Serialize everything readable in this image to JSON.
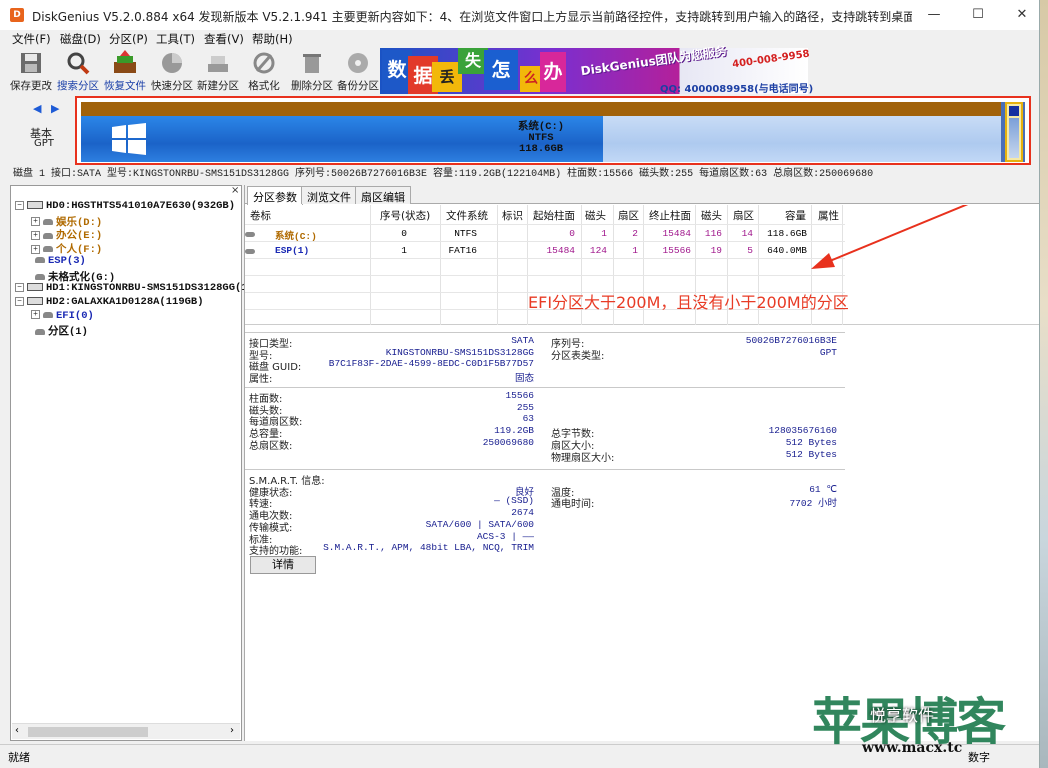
{
  "window": {
    "title": "DiskGenius V5.2.0.884 x64   发现新版本 V5.2.1.941 主要更新内容如下：4、在浏览文件窗口上方显示当前路径控件，支持跳转到用户输入的路径，支持跳转到桌面及我的文档。",
    "app_icon_glyph": "D",
    "minimize": "—",
    "maximize": "☐",
    "close": "✕"
  },
  "menu": [
    "文件(F)",
    "磁盘(D)",
    "分区(P)",
    "工具(T)",
    "查看(V)",
    "帮助(H)"
  ],
  "toolbar": [
    {
      "label": "保存更改",
      "icon": "save-disk-icon"
    },
    {
      "label": "搜索分区",
      "icon": "magnifier-icon"
    },
    {
      "label": "恢复文件",
      "icon": "recover-files-icon"
    },
    {
      "label": "快速分区",
      "icon": "pie-chart-icon"
    },
    {
      "label": "新建分区",
      "icon": "new-partition-icon"
    },
    {
      "label": "格式化",
      "icon": "format-icon"
    },
    {
      "label": "删除分区",
      "icon": "trash-icon"
    },
    {
      "label": "备份分区",
      "icon": "backup-icon"
    }
  ],
  "banner": {
    "chars": [
      "数",
      "据",
      "丢",
      "失",
      "怎",
      "么",
      "办"
    ],
    "brand": "DiskGenius团队为您服务",
    "phone": "400-008-9958",
    "qq": "QQ: 4000089958(与电话同号)"
  },
  "disk_map": {
    "nav_arrows": "◀ ▶",
    "kind": "基本",
    "style": "GPT",
    "partition_label": "系统(C:)",
    "partition_fs": "NTFS",
    "partition_size": "118.6GB",
    "used_fraction": 0.567
  },
  "disk_info": "磁盘 1 接口:SATA  型号:KINGSTONRBU-SMS151DS3128GG  序列号:50026B7276016B3E  容量:119.2GB(122104MB)  柱面数:15566  磁头数:255  每道扇区数:63  总扇区数:250069680",
  "tree": {
    "close": "×",
    "items": [
      {
        "label": "HD0:HGSTHTS541010A7E630(932GB)",
        "kind": "disk",
        "color": "#111"
      },
      {
        "label": "娱乐(D:)",
        "kind": "part",
        "color": "#b06a00"
      },
      {
        "label": "办公(E:)",
        "kind": "part",
        "color": "#b06a00"
      },
      {
        "label": "个人(F:)",
        "kind": "part",
        "color": "#b06a00"
      },
      {
        "label": "ESP(3)",
        "kind": "part",
        "color": "#1b2ab4"
      },
      {
        "label": "未格式化(G:)",
        "kind": "part",
        "color": "#111"
      },
      {
        "label": "HD1:KINGSTONRBU-SMS151DS3128GG(1",
        "kind": "disk",
        "color": "#111"
      },
      {
        "label": "HD2:GALAXKA1D0128A(119GB)",
        "kind": "disk",
        "color": "#111"
      },
      {
        "label": "EFI(0)",
        "kind": "part",
        "color": "#1b2ab4"
      },
      {
        "label": "分区(1)",
        "kind": "part",
        "color": "#111"
      }
    ]
  },
  "tabs": [
    "分区参数",
    "浏览文件",
    "扇区编辑"
  ],
  "table": {
    "headers": [
      "卷标",
      "序号(状态)",
      "文件系统",
      "标识",
      "起始柱面",
      "磁头",
      "扇区",
      "终止柱面",
      "磁头",
      "扇区",
      "容量",
      "属性"
    ],
    "rows": [
      [
        "系统(C:)",
        "0",
        "NTFS",
        "",
        "0",
        "1",
        "2",
        "15484",
        "116",
        "14",
        "118.6GB",
        ""
      ],
      [
        "ESP(1)",
        "1",
        "FAT16",
        "",
        "15484",
        "124",
        "1",
        "15566",
        "19",
        "5",
        "640.0MB",
        ""
      ]
    ]
  },
  "annotation": "EFI分区大于200M，且没有小于200M的分区",
  "info1": [
    {
      "k": "接口类型:",
      "v": "SATA",
      "k2": "序列号:",
      "v2": "50026B7276016B3E"
    },
    {
      "k": "型号:",
      "v": "KINGSTONRBU-SMS151DS3128GG",
      "k2": "分区表类型:",
      "v2": "GPT"
    },
    {
      "k": "磁盘 GUID:",
      "v": "B7C1F83F-2DAE-4599-8EDC-C0D1F5B77D57",
      "k2": "",
      "v2": ""
    },
    {
      "k": "属性:",
      "v": "固态",
      "k2": "",
      "v2": ""
    }
  ],
  "info2": [
    {
      "k": "柱面数:",
      "v": "15566",
      "k2": "",
      "v2": ""
    },
    {
      "k": "磁头数:",
      "v": "255",
      "k2": "",
      "v2": ""
    },
    {
      "k": "每道扇区数:",
      "v": "63",
      "k2": "",
      "v2": ""
    },
    {
      "k": "总容量:",
      "v": "119.2GB",
      "k2": "总字节数:",
      "v2": "128035676160"
    },
    {
      "k": "总扇区数:",
      "v": "250069680",
      "k2": "扇区大小:",
      "v2": "512 Bytes"
    },
    {
      "k": "",
      "v": "",
      "k2": "物理扇区大小:",
      "v2": "512 Bytes"
    }
  ],
  "info3": [
    {
      "k": "S.M.A.R.T. 信息:",
      "v": "",
      "k2": "",
      "v2": ""
    },
    {
      "k": "健康状态:",
      "v": "良好",
      "k2": "温度:",
      "v2": "61 ℃"
    },
    {
      "k": "转速:",
      "v": "— (SSD)",
      "k2": "通电时间:",
      "v2": "7702 小时"
    },
    {
      "k": "通电次数:",
      "v": "2674",
      "k2": "",
      "v2": ""
    },
    {
      "k": "传输模式:",
      "v": "SATA/600 | SATA/600",
      "k2": "",
      "v2": ""
    },
    {
      "k": "标准:",
      "v": "ACS-3 | ——",
      "k2": "",
      "v2": ""
    },
    {
      "k": "支持的功能:",
      "v": "S.M.A.R.T., APM, 48bit LBA, NCQ, TRIM",
      "k2": "",
      "v2": ""
    }
  ],
  "detail_button": "详情",
  "status": {
    "ready": "就绪",
    "num": "数字"
  },
  "watermark": {
    "big": "苹果博客",
    "chat": "悦享软件",
    "url": "www.macx.tc"
  }
}
